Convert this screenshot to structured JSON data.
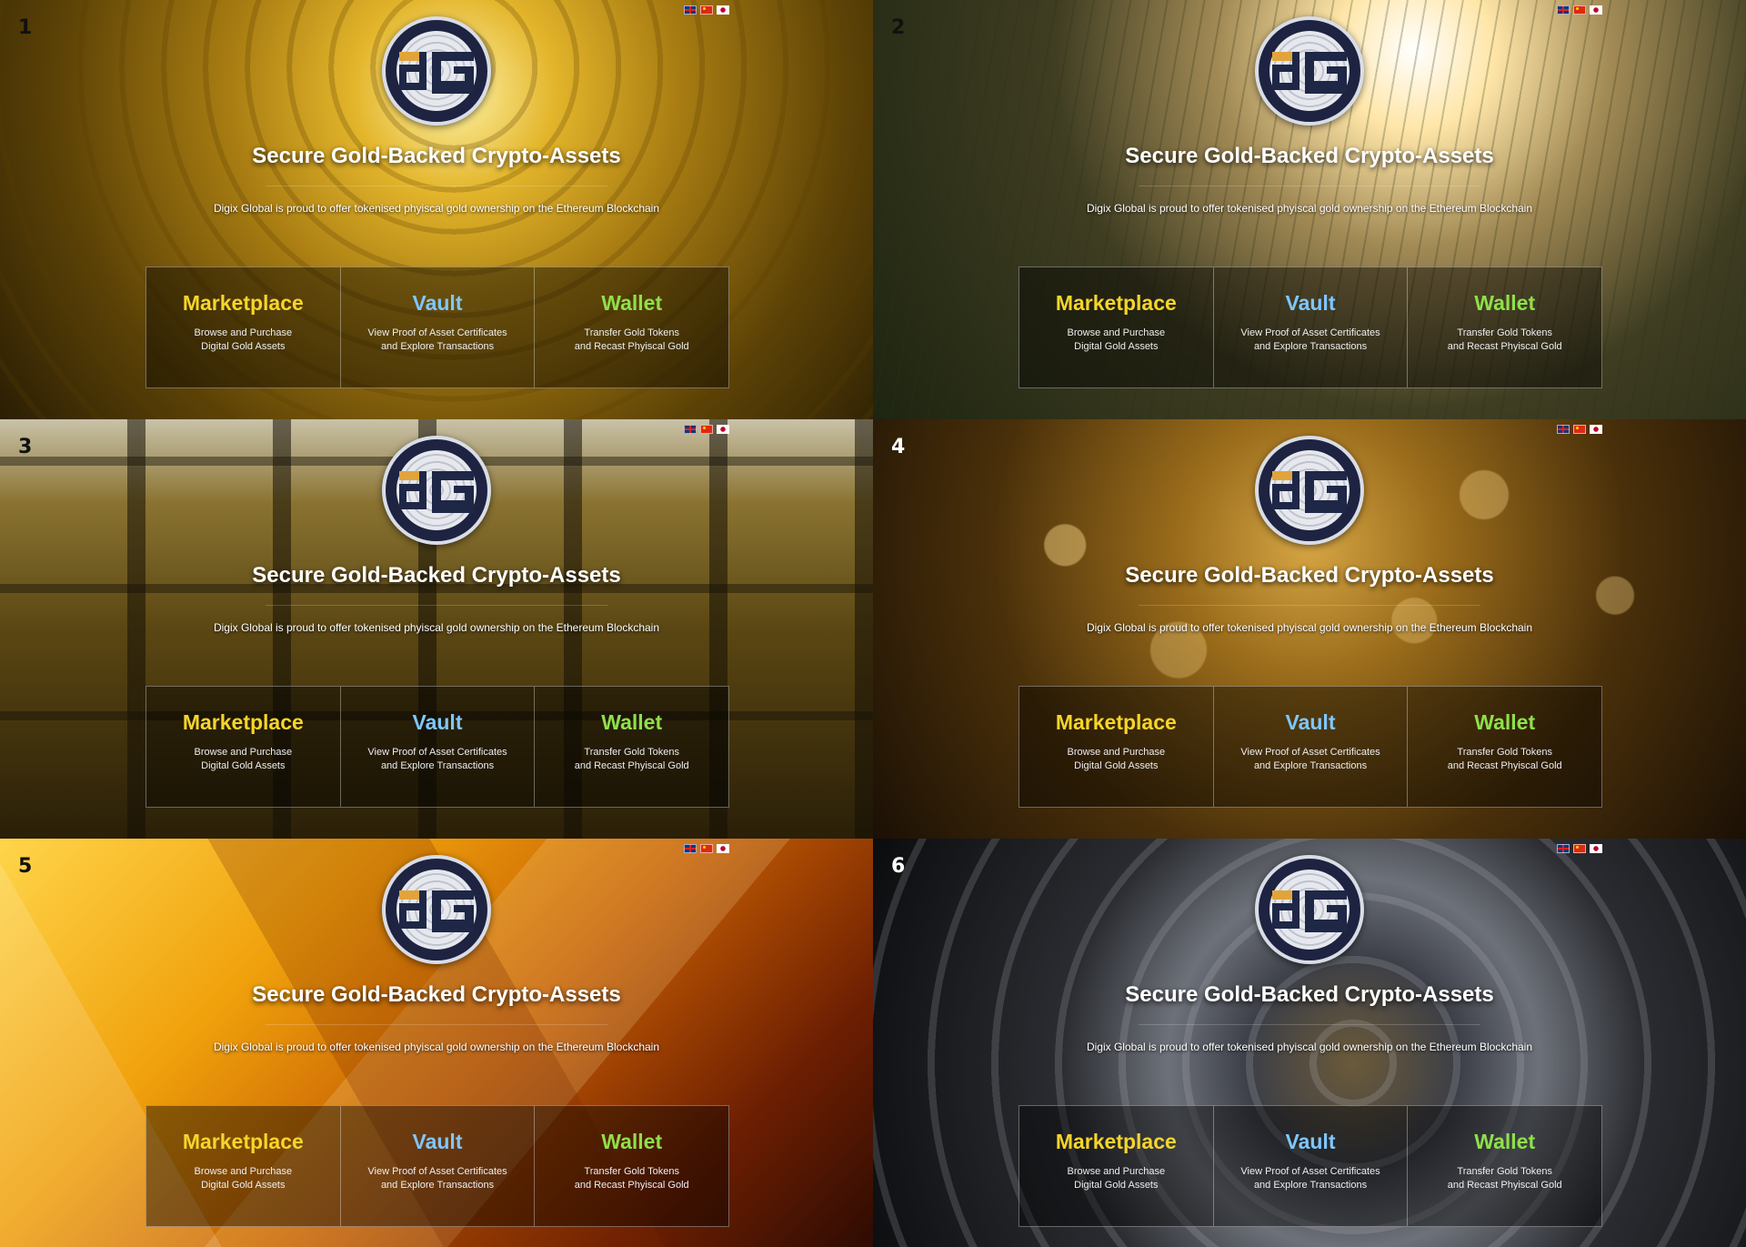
{
  "panels": [
    {
      "number": "1",
      "theme": "gold-ornament"
    },
    {
      "number": "2",
      "theme": "field-sunset"
    },
    {
      "number": "3",
      "theme": "gold-bars"
    },
    {
      "number": "4",
      "theme": "gold-bokeh"
    },
    {
      "number": "5",
      "theme": "gold-crystal"
    },
    {
      "number": "6",
      "theme": "vault-door"
    }
  ],
  "headline": "Secure Gold-Backed Crypto-Assets",
  "tagline": "Digix Global is proud to offer tokenised phyiscal gold ownership on the Ethereum Blockchain",
  "logo_text": "dG",
  "languages": [
    "uk-flag-icon",
    "china-flag-icon",
    "japan-flag-icon"
  ],
  "menu": {
    "marketplace": {
      "title": "Marketplace",
      "line1": "Browse and Purchase",
      "line2": "Digital Gold Assets",
      "color": "#f6d52a"
    },
    "vault": {
      "title": "Vault",
      "line1": "View Proof of Asset Certificates",
      "line2": "and Explore Transactions",
      "color": "#7fc7ff"
    },
    "wallet": {
      "title": "Wallet",
      "line1": "Transfer Gold Tokens",
      "line2": "and Recast Phyiscal Gold",
      "color": "#8fe04a"
    }
  }
}
